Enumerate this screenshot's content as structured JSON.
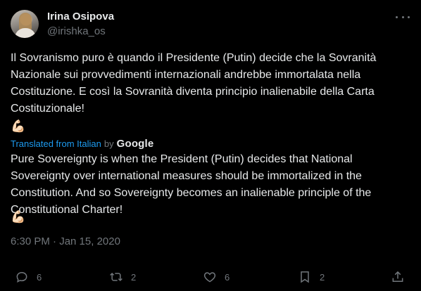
{
  "author": {
    "name": "Irina Osipova",
    "handle": "@irishka_os"
  },
  "tweet": {
    "original_text": "Il Sovranismo puro è quando il Presidente (Putin) decide che la Sovranità Nazionale sui provvedimenti internazionali andrebbe immortalata nella Costituzione. E così la Sovranità diventa principio inalienabile della Carta Costituzionale!",
    "original_emoji": "💪🏻",
    "translation_label": "Translated from Italian",
    "translation_by": "by",
    "translation_provider": "Google",
    "translated_text": "Pure Sovereignty is when the President (Putin) decides that National Sovereignty over international measures should be immortalized in the Constitution. And so Sovereignty becomes an inalienable principle of the Constitutional Charter!",
    "translated_emoji": "💪🏻",
    "timestamp": "6:30 PM · Jan 15, 2020"
  },
  "actions": {
    "replies": "6",
    "retweets": "2",
    "likes": "6",
    "bookmarks": "2"
  },
  "colors": {
    "background": "#000000",
    "text": "#e7e9ea",
    "muted": "#71767b",
    "link": "#1d9bf0"
  },
  "icons": [
    "more-icon",
    "reply-icon",
    "retweet-icon",
    "like-icon",
    "bookmark-icon",
    "share-icon"
  ]
}
